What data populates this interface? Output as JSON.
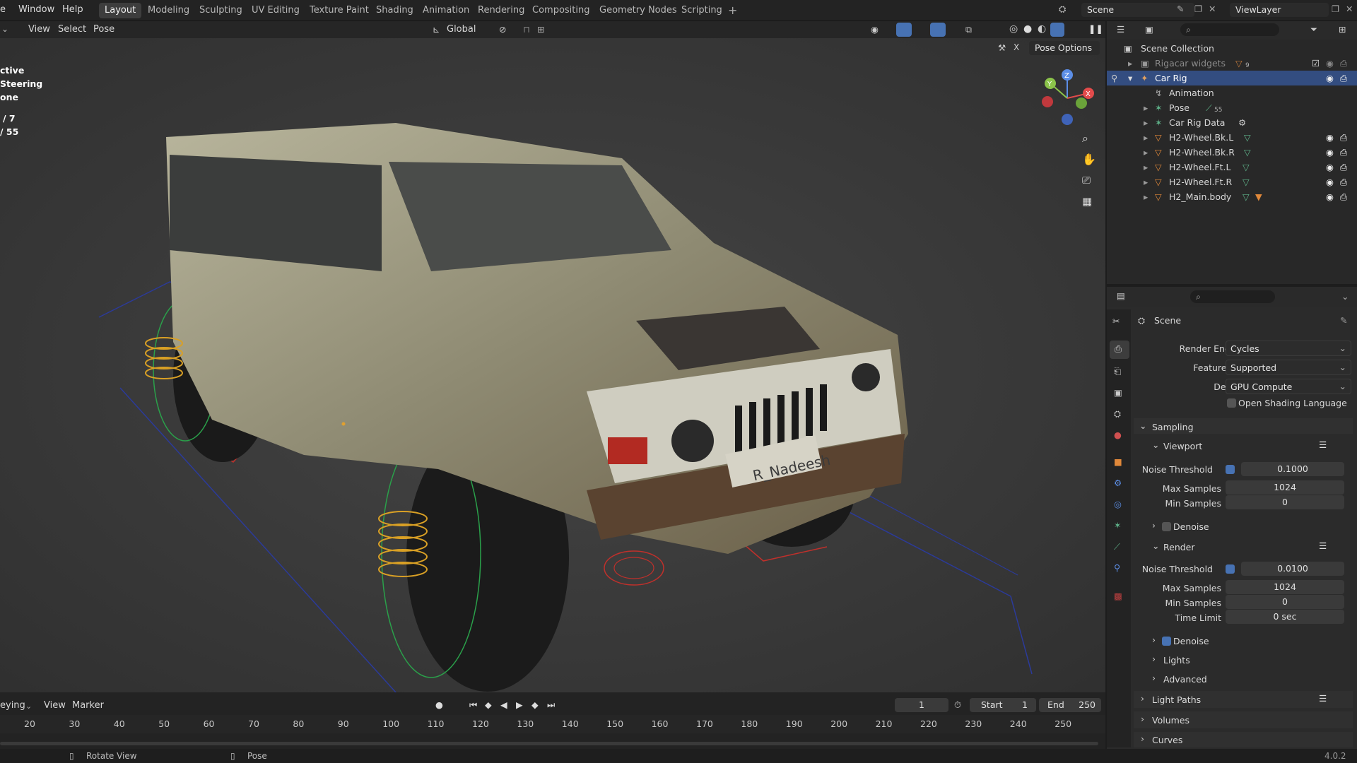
{
  "menus": [
    "Window",
    "Help"
  ],
  "workspaces": [
    "Layout",
    "Modeling",
    "Sculpting",
    "UV Editing",
    "Texture Paint",
    "Shading",
    "Animation",
    "Rendering",
    "Compositing",
    "Geometry Nodes",
    "Scripting"
  ],
  "active_workspace": "Layout",
  "scene_name": "Scene",
  "view_layer": "ViewLayer",
  "viewport_header": {
    "view": "View",
    "select": "Select",
    "pose": "Pose",
    "transform": "Global",
    "pose_options": "Pose Options"
  },
  "viewport_info": {
    "line1": "ctive",
    "line2": "Steering",
    "line3": "one",
    "line4": "/ 7",
    "line5": "/ 55"
  },
  "plate_text": "R_Nadeesh",
  "outliner": {
    "root": "Scene Collection",
    "rows": [
      {
        "label": "Rigacar widgets",
        "badge": "9"
      },
      {
        "label": "Car Rig"
      },
      {
        "label": "Animation"
      },
      {
        "label": "Pose",
        "badge": "55"
      },
      {
        "label": "Car Rig Data"
      },
      {
        "label": "H2-Wheel.Bk.L"
      },
      {
        "label": "H2-Wheel.Bk.R"
      },
      {
        "label": "H2-Wheel.Ft.L"
      },
      {
        "label": "H2-Wheel.Ft.R"
      },
      {
        "label": "H2_Main.body"
      }
    ]
  },
  "properties": {
    "title": "Scene",
    "render_engine_label": "Render Engine",
    "render_engine": "Cycles",
    "feature_set_label": "Feature Set",
    "feature_set": "Supported",
    "device_label": "Device",
    "device": "GPU Compute",
    "osl": "Open Shading Language",
    "sampling": "Sampling",
    "viewport": "Viewport",
    "vp_noise_label": "Noise Threshold",
    "vp_noise": "0.1000",
    "vp_max_label": "Max Samples",
    "vp_max": "1024",
    "vp_min_label": "Min Samples",
    "vp_min": "0",
    "vp_denoise": "Denoise",
    "render": "Render",
    "r_noise_label": "Noise Threshold",
    "r_noise": "0.0100",
    "r_max_label": "Max Samples",
    "r_max": "1024",
    "r_min_label": "Min Samples",
    "r_min": "0",
    "r_time_label": "Time Limit",
    "r_time": "0 sec",
    "r_denoise": "Denoise",
    "lights": "Lights",
    "advanced": "Advanced",
    "light_paths": "Light Paths",
    "volumes": "Volumes",
    "curves": "Curves"
  },
  "timeline": {
    "keying": "eying",
    "view": "View",
    "marker": "Marker",
    "current_frame": "1",
    "start_label": "Start",
    "start": "1",
    "end_label": "End",
    "end": "250",
    "ticks": [
      "20",
      "30",
      "40",
      "50",
      "60",
      "70",
      "80",
      "90",
      "100",
      "110",
      "120",
      "130",
      "140",
      "150",
      "160",
      "170",
      "180",
      "190",
      "200",
      "210",
      "220",
      "230",
      "240",
      "250"
    ]
  },
  "status": {
    "left": "Rotate View",
    "mid": "Pose",
    "version": "4.0.2"
  }
}
